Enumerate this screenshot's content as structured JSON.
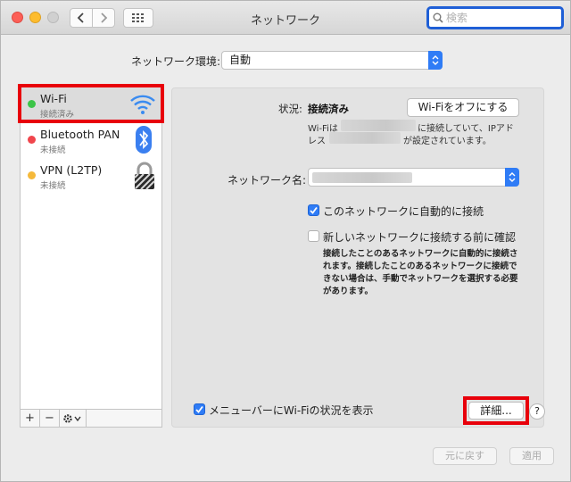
{
  "window": {
    "title": "ネットワーク"
  },
  "search": {
    "placeholder": "検索"
  },
  "location": {
    "label": "ネットワーク環境:",
    "value": "自動"
  },
  "services": [
    {
      "name": "Wi-Fi",
      "status": "接続済み",
      "dot_color": "#3cc448",
      "icon": "wifi-icon"
    },
    {
      "name": "Bluetooth PAN",
      "status": "未接続",
      "dot_color": "#f0454c",
      "icon": "bluetooth-icon"
    },
    {
      "name": "VPN (L2TP)",
      "status": "未接続",
      "dot_color": "#f5b93a",
      "icon": "lock-icon"
    }
  ],
  "sidebar_footer": {
    "add": "+",
    "remove": "−"
  },
  "detail": {
    "status_label": "状況:",
    "status_value": "接続済み",
    "wifi_off_button": "Wi-Fiをオフにする",
    "desc_line1_a": "Wi-Fiは",
    "desc_line1_b": "に接続していて、IPアド",
    "desc_line2_a": "レス",
    "desc_line2_b": "が設定されています。",
    "network_name_label": "ネットワーク名:",
    "auto_join_label": "このネットワークに自動的に接続",
    "auto_join_checked": true,
    "ask_join_label": "新しいネットワークに接続する前に確認",
    "ask_join_checked": false,
    "ask_join_help": "接続したことのあるネットワークに自動的に接続されます。接続したことのあるネットワークに接続できない場合は、手動でネットワークを選択する必要があります。",
    "menubar_label": "メニューバーにWi-Fiの状況を表示",
    "menubar_checked": true,
    "advanced_button": "詳細...",
    "help_button": "?"
  },
  "footer": {
    "revert": "元に戻す",
    "apply": "適用"
  },
  "colors": {
    "accent": "#2f7cf6",
    "highlight_box": "#e8000b"
  }
}
